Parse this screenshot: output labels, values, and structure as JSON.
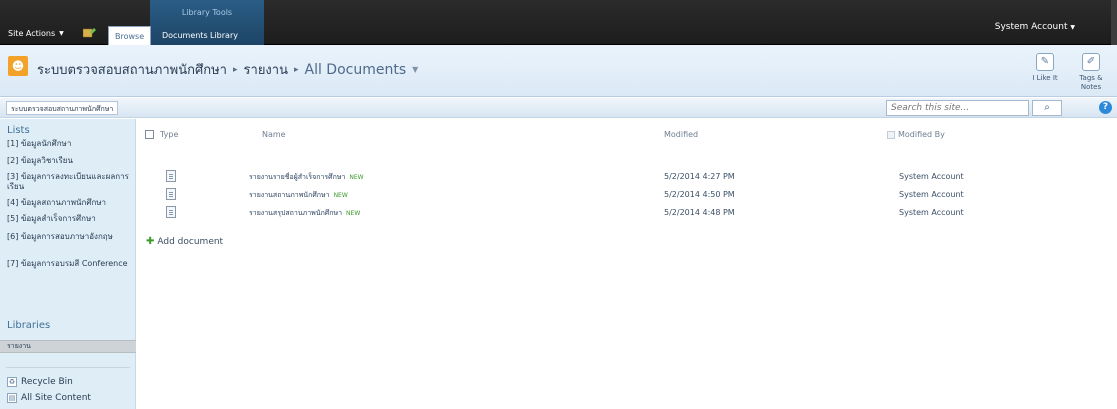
{
  "ribbon": {
    "site_actions": "Site Actions",
    "context_group": "Library Tools",
    "tabs": [
      "Browse",
      "Documents",
      "Library"
    ],
    "account": "System Account"
  },
  "title": {
    "site": "ระบบตรวจสอบสถานภาพนักศึกษา",
    "list": "รายงาน",
    "view": "All Documents"
  },
  "social": {
    "like": "I Like It",
    "tags": "Tags & Notes"
  },
  "topbar": {
    "home": "ระบบตรวจสอบสถานภาพนักศึกษา",
    "search_placeholder": "Search this site..."
  },
  "leftnav": {
    "lists_heading": "Lists",
    "lists": [
      "[1] ข้อมูลนักศึกษา",
      "[2] ข้อมูลวิชาเรียน",
      "[3] ข้อมูลการลงทะเบียนและผลการเรียน",
      "[4] ข้อมูลสถานภาพนักศึกษา",
      "[5] ข้อมูลสำเร็จการศึกษา",
      "[6] ข้อมูลการสอบภาษาอังกฤษ",
      "[7] ข้อมูลการอบรมสี Conference"
    ],
    "libraries_heading": "Libraries",
    "libraries": [
      "รายงาน"
    ],
    "recycle_bin": "Recycle Bin",
    "all_site_content": "All Site Content"
  },
  "table": {
    "headers": {
      "type": "Type",
      "name": "Name",
      "modified": "Modified",
      "modified_by": "Modified By"
    },
    "rows": [
      {
        "name": "รายงานรายชื่อผู้สำเร็จการศึกษา",
        "new": "NEW",
        "modified": "5/2/2014 4:27 PM",
        "modified_by": "System Account"
      },
      {
        "name": "รายงานสถานภาพนักศึกษา",
        "new": "NEW",
        "modified": "5/2/2014 4:50 PM",
        "modified_by": "System Account"
      },
      {
        "name": "รายงานสรุปสถานภาพนักศึกษา",
        "new": "NEW",
        "modified": "5/2/2014 4:48 PM",
        "modified_by": "System Account"
      }
    ],
    "add_document": "Add document"
  }
}
